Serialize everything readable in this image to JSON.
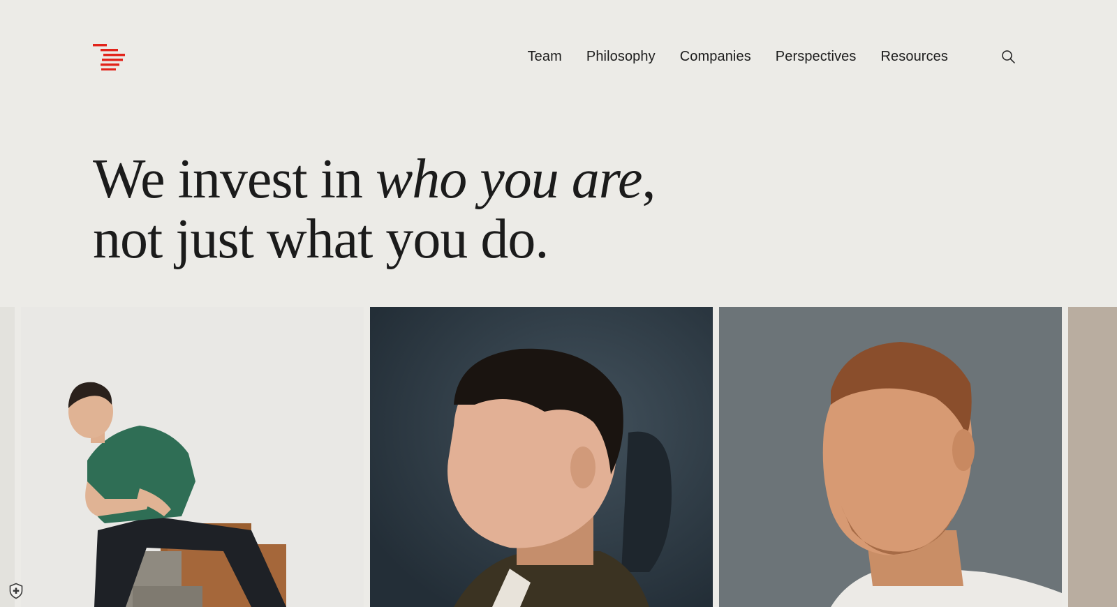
{
  "brand": {
    "accent_color": "#e2231a",
    "logo_icon": "stacked-lines-logo"
  },
  "nav": {
    "items": [
      {
        "label": "Team"
      },
      {
        "label": "Philosophy"
      },
      {
        "label": "Companies"
      },
      {
        "label": "Perspectives"
      },
      {
        "label": "Resources"
      }
    ],
    "search_icon": "search-icon"
  },
  "hero": {
    "line1_prefix": "We invest in ",
    "line1_emphasis": "who you are",
    "line1_suffix": ",",
    "line2": "not just what you do."
  },
  "gallery": {
    "cards": [
      {
        "icon": "portrait-photo-man-green-shirt-sitting"
      },
      {
        "icon": "portrait-photo-young-man-profile"
      },
      {
        "icon": "portrait-photo-man-looking-up"
      },
      {
        "icon": "portrait-photo-partial"
      }
    ]
  },
  "privacy_badge_icon": "shield-icon"
}
